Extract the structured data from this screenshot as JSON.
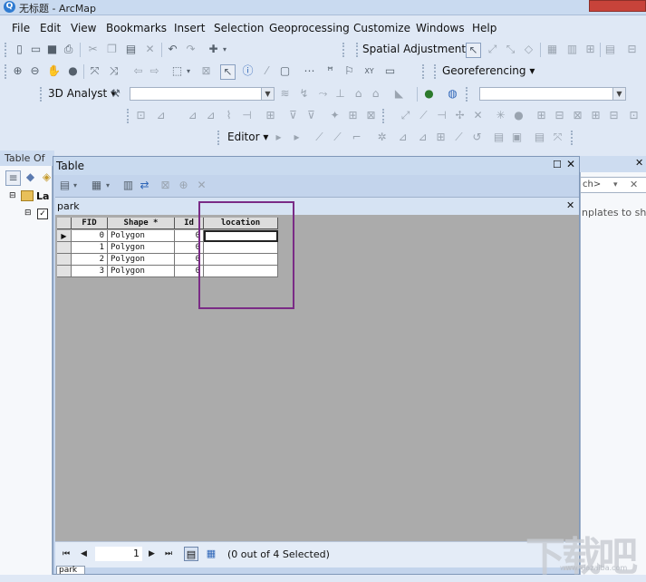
{
  "window": {
    "title": "无标题 - ArcMap",
    "app_icon": "arcmap-globe-icon"
  },
  "menu": [
    "File",
    "Edit",
    "View",
    "Bookmarks",
    "Insert",
    "Selection",
    "Geoprocessing",
    "Customize",
    "Windows",
    "Help"
  ],
  "toolbars": {
    "spatial_adjustment": "Spatial Adjustment",
    "georeferencing": "Georeferencing",
    "analyst_3d": "3D Analyst",
    "editor": "Editor"
  },
  "toc": {
    "title": "Table Of",
    "layer_label": "La"
  },
  "right_panel": {
    "search_placeholder": "ch>",
    "hint": "nplates to sho"
  },
  "table_window": {
    "title": "Table",
    "tab_name": "park",
    "columns": [
      "FID",
      "Shape *",
      "Id",
      "location"
    ],
    "rows": [
      {
        "fid": "0",
        "shape": "Polygon",
        "id": "0",
        "location": ""
      },
      {
        "fid": "1",
        "shape": "Polygon",
        "id": "0",
        "location": ""
      },
      {
        "fid": "2",
        "shape": "Polygon",
        "id": "0",
        "location": ""
      },
      {
        "fid": "3",
        "shape": "Polygon",
        "id": "0",
        "location": ""
      }
    ],
    "current_record": "1",
    "selection_status": "(0 out of 4 Selected)",
    "bottom_tab": "park"
  },
  "watermark": {
    "text": "下载吧",
    "sub": "www.xiazaiba.com"
  },
  "colors": {
    "highlight": "#7a2b86",
    "titlebar": "#c9daf0",
    "close": "#c7433a"
  }
}
